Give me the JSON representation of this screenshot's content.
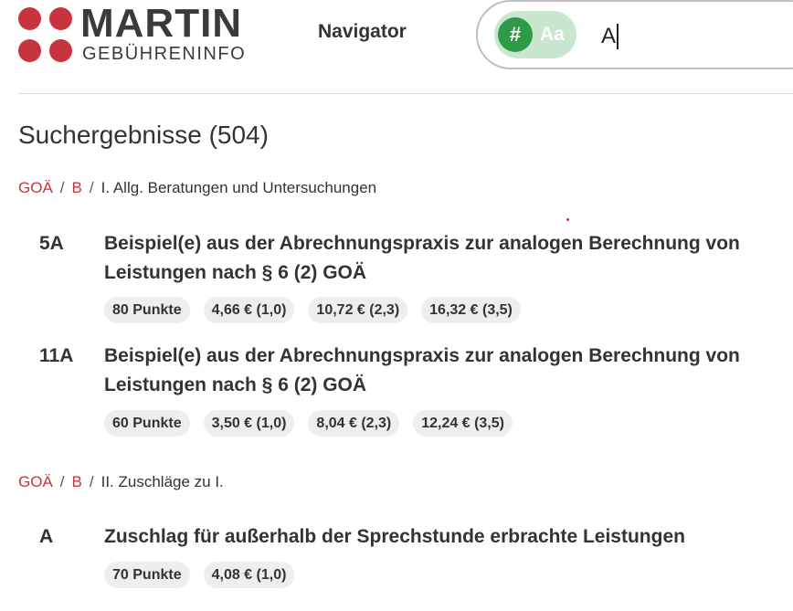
{
  "header": {
    "logo_title": "MARTIN",
    "logo_subtitle": "GEBÜHRENINFO",
    "nav_label": "Navigator",
    "search": {
      "mode_hash": "#",
      "mode_text": "Aa",
      "value": "A"
    }
  },
  "results": {
    "title": "Suchergebnisse (504)",
    "groups": [
      {
        "breadcrumb": [
          "GOÄ",
          "B",
          "I. Allg. Beratungen und Untersuchungen"
        ],
        "items": [
          {
            "code": "5A",
            "description": "Beispiel(e) aus der Abrechnungspraxis zur analogen Berechnung von Leistungen nach § 6 (2) GOÄ",
            "badges": [
              "80 Punkte",
              "4,66 € (1,0)",
              "10,72 € (2,3)",
              "16,32 € (3,5)"
            ]
          },
          {
            "code": "11A",
            "description": "Beispiel(e) aus der Abrechnungspraxis zur analogen Berechnung von Leistungen nach § 6 (2) GOÄ",
            "badges": [
              "60 Punkte",
              "3,50 € (1,0)",
              "8,04 € (2,3)",
              "12,24 € (3,5)"
            ]
          }
        ]
      },
      {
        "breadcrumb": [
          "GOÄ",
          "B",
          "II. Zuschläge zu I."
        ],
        "items": [
          {
            "code": "A",
            "description": "Zuschlag für außerhalb der Sprechstunde erbrachte Leistungen",
            "badges": [
              "70 Punkte",
              "4,08 € (1,0)"
            ]
          }
        ]
      }
    ]
  },
  "colors": {
    "brand_red": "#c7333e",
    "toggle_green": "#2f9a45",
    "toggle_bg": "#c9e6cf",
    "badge_bg": "#eeeeee"
  }
}
